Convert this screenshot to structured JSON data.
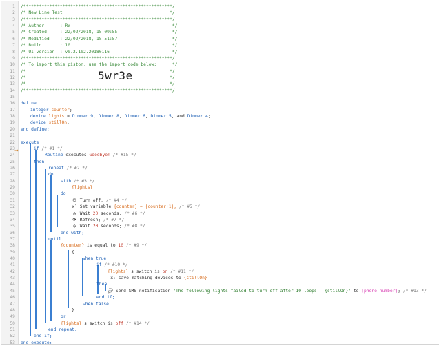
{
  "line_numbers": [
    "1",
    "2",
    "3",
    "4",
    "5",
    "6",
    "7",
    "8",
    "9",
    "10",
    "11",
    "12",
    "13",
    "14",
    "15",
    "16",
    "17",
    "18",
    "19",
    "20",
    "21",
    "22",
    "23",
    "24",
    "25",
    "26",
    "27",
    "28",
    "29",
    "30",
    "31",
    "32",
    "33",
    "34",
    "35",
    "36",
    "37",
    "38",
    "39",
    "40",
    "41",
    "42",
    "43",
    "44",
    "45",
    "46",
    "47",
    "48",
    "49",
    "50",
    "51",
    "52",
    "53"
  ],
  "header": {
    "stars": "/*********************************************************/",
    "title": "/* New Line Test                                         */",
    "author": "/* Author      : RW                                       */",
    "created": "/* Created     : 22/02/2018, 15:09:55                     */",
    "modified": "/* Modified    : 22/02/2018, 18:51:57                     */",
    "build": "/* Build       : 10                                       */",
    "ui_version": "/* UI version  : v0.2.102.20180116                        */",
    "import_note": "/* To import this piston, use the import code below:      */",
    "blank": "/*                                                       */",
    "import_code": "5wr3e"
  },
  "code": {
    "define": "define",
    "integer_kw": "integer",
    "counter": "counter",
    "device_kw": "device",
    "lights": "lights",
    "assign": "=",
    "dimmer9": "Dimmer 9",
    "dimmer8": "Dimmer 8",
    "dimmer6": "Dimmer 6",
    "dimmer5": "Dimmer 5",
    "and": "and",
    "dimmer4": "Dimmer 4",
    "stillon": "stillOn",
    "end_define": "end define;",
    "execute": "execute",
    "if": "if",
    "c1": "/* #1 */",
    "routine": "Routine",
    "executes": "executes",
    "goodbye": "Goodbye!",
    "c15": "/* #15 */",
    "then": "then",
    "repeat": "repeat",
    "c2": "/* #2 */",
    "do": "do",
    "with": "with",
    "c3": "/* #3 */",
    "lights_ref": "{lights}",
    "turn_off": "Turn off;",
    "c4": "/* #4 */",
    "set_variable": "Set variable",
    "counter_ref": "{counter}",
    "counter_expr": "= {counter+1};",
    "c5": "/* #5 */",
    "wait": "Wait",
    "twenty": "20",
    "seconds": "seconds;",
    "c6": "/* #6 */",
    "refresh": "Refresh;",
    "c7": "/* #7 */",
    "c8": "/* #8 */",
    "end_with": "end with;",
    "until": "until",
    "is_equal_to": "is equal to",
    "ten": "10",
    "c9": "/* #9 */",
    "open_brace": "{",
    "when_true": "when true",
    "c10": "/* #10 */",
    "switch_is": "'s switch is",
    "on": "on",
    "c11": "/* #11 */",
    "save_matching": "save matching devices to",
    "stillon_ref": "{stillOn}",
    "send_sms": "Send SMS notification",
    "sms_text": "\"The following lights failed to turn off after 10 loops - {stillOn}\"",
    "to": "to",
    "phone": "[phone number]",
    "c13": "/* #13 */",
    "end_if": "end if;",
    "when_false": "when false",
    "close_brace": "}",
    "or": "or",
    "off": "off",
    "c14": "/* #14 */",
    "end_repeat": "end repeat;",
    "end_execute": "end execute;"
  },
  "colors": {
    "comment": "#3a8a3a",
    "keyword": "#1d5fb4",
    "variable": "#d76a1a",
    "device": "#1d5fb4",
    "value": "#c0392b",
    "phone": "#d63ab0",
    "bar": "#3b7fd1"
  },
  "icons": [
    "power-icon",
    "variable-icon",
    "timer-icon",
    "refresh-icon",
    "sms-icon",
    "condition-arrow-icon"
  ]
}
